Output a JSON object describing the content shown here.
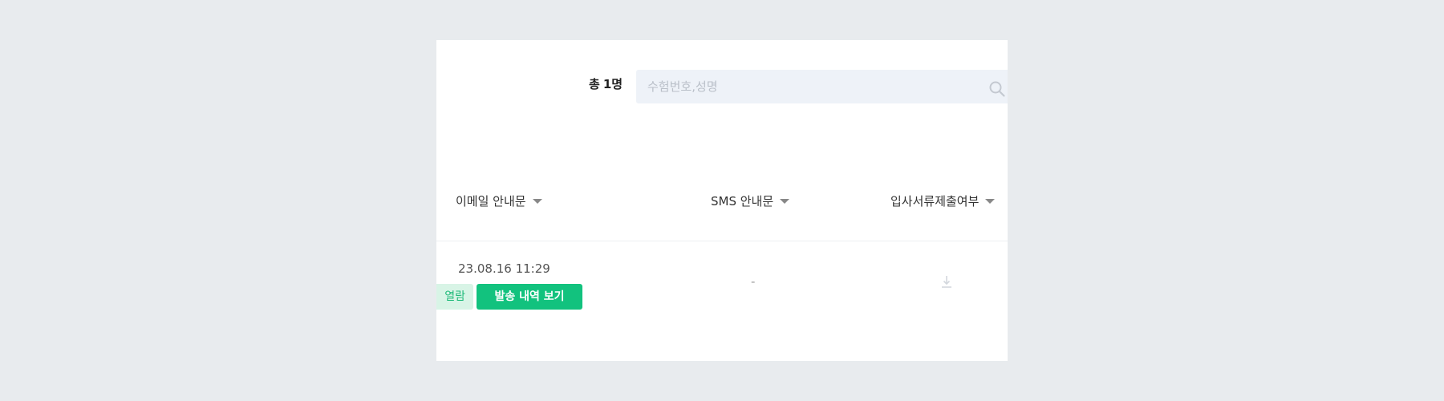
{
  "toolbar": {
    "count_prefix": "총",
    "count_value": "1명",
    "search_placeholder": "수험번호,성명",
    "search_value": ""
  },
  "table": {
    "columns": [
      {
        "label": "이메일 안내문"
      },
      {
        "label": "SMS 안내문"
      },
      {
        "label": "입사서류제출여부"
      }
    ],
    "rows": [
      {
        "email_sent_at": "23.08.16 11:29",
        "email_status": "열람",
        "email_history_button": "발송 내역 보기",
        "sms": "-",
        "docs_icon": "download-icon"
      }
    ]
  },
  "icons": {
    "search": "search-icon",
    "sort": "caret-down-icon",
    "download": "download-icon"
  },
  "colors": {
    "page_bg": "#e8ebee",
    "panel_bg": "#ffffff",
    "search_bg": "#eef2f8",
    "accent_green": "#12c27e",
    "read_tag_bg": "#d8f4e6",
    "read_tag_text": "#1fba7a"
  }
}
